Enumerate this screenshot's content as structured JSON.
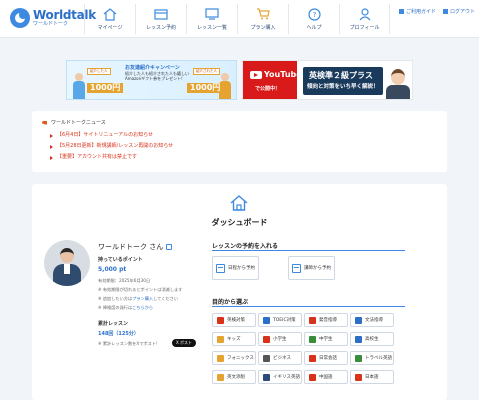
{
  "brand": {
    "name": "Worldtalk",
    "sub": "ワールドトーク"
  },
  "nav": [
    {
      "label": "マイページ",
      "icon": "home-icon"
    },
    {
      "label": "レッスン予約",
      "icon": "calendar-icon"
    },
    {
      "label": "レッスン一覧",
      "icon": "monitor-icon"
    },
    {
      "label": "プラン購入",
      "icon": "cart-icon"
    },
    {
      "label": "ヘルプ",
      "icon": "help-icon"
    },
    {
      "label": "プロフィール",
      "icon": "profile-icon"
    }
  ],
  "top_links": {
    "guide": "ご利用ガイド",
    "logout": "ログアウト"
  },
  "banner_campaign": {
    "title": "お友達紹介キャンペーン",
    "text1": "紹介した人も紹介された人も嬉しい",
    "text2": "Amazonギフト券をプレゼント!",
    "tag_left": "紹介した人",
    "tag_right": "紹介された人",
    "price_left": "1000円",
    "price_right": "1000円"
  },
  "banner_youtube": {
    "name": "YouTube",
    "sub": "で公開中！",
    "line1": "英検準２級プラス",
    "line2": "傾向と対策をいち早く解説！"
  },
  "news": {
    "title": "ワールドトークニュース",
    "items": [
      "【6月4日】サイトリニューアルのお知らせ",
      "【5月28日更新】新規講師/レッスン再開のお知らせ",
      "【重要】アカウント共有は禁止です"
    ]
  },
  "dashboard": {
    "title": "ダッシュボード",
    "user_name": "ワールドトーク さん",
    "points_label": "持っているポイント",
    "points_value": "5,000 pt",
    "expiry": "有効期限：2025年6月30日",
    "note1": "※ 有効期限が切れるとポイントは消滅します",
    "note2_prefix": "※ 追加したい方は",
    "note2_link": "プラン購入",
    "note2_suffix": "してください",
    "note3_prefix": "※ 降格度の発行は",
    "note3_link": "こちらから",
    "lessons_label": "累計レッスン",
    "lessons_value": "148回（125分）",
    "lessons_note": "※ 累計レッスン数をXでポスト!",
    "x_post": "X ポスト"
  },
  "reserve": {
    "title": "レッスンの予約を入れる",
    "by_date": "日程から予約",
    "by_teacher": "講師から予約"
  },
  "purpose": {
    "title": "目的から選ぶ",
    "items": [
      {
        "label": "英検対策",
        "color": "#d8331a"
      },
      {
        "label": "TOEIC対策",
        "color": "#2c6fc8"
      },
      {
        "label": "発音指導",
        "color": "#d8331a"
      },
      {
        "label": "文法指導",
        "color": "#2c6fc8"
      },
      {
        "label": "キッズ",
        "color": "#e5a431"
      },
      {
        "label": "小学生",
        "color": "#d8331a"
      },
      {
        "label": "中学生",
        "color": "#3a8d3a"
      },
      {
        "label": "高校生",
        "color": "#2c6fc8"
      },
      {
        "label": "フォニックス",
        "color": "#e5a431"
      },
      {
        "label": "ビジネス",
        "color": "#555555"
      },
      {
        "label": "日常会話",
        "color": "#d8331a"
      },
      {
        "label": "トラベル英語",
        "color": "#3a8d3a"
      },
      {
        "label": "英文添削",
        "color": "#e5a431"
      },
      {
        "label": "イギリス英語",
        "color": "#2c4a7a"
      },
      {
        "label": "中国語",
        "color": "#d8331a"
      },
      {
        "label": "日本語",
        "color": "#d8331a"
      }
    ]
  }
}
